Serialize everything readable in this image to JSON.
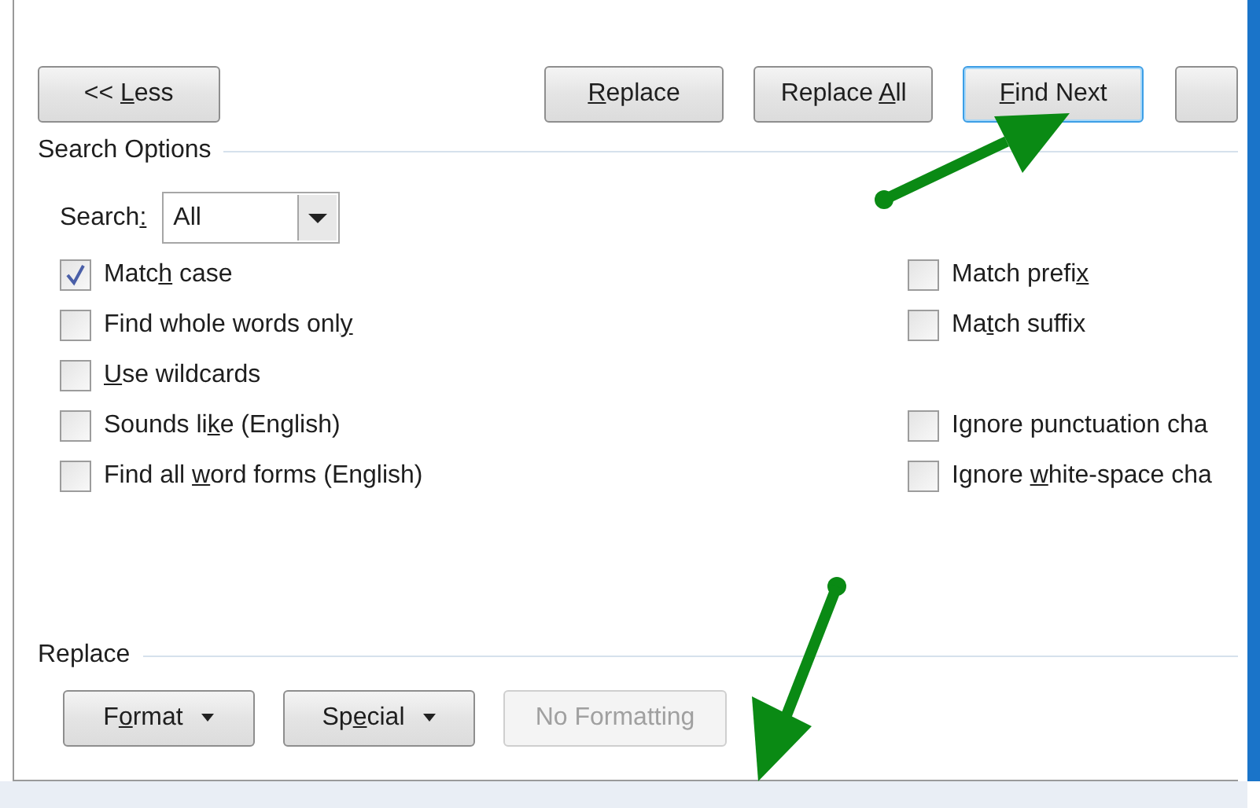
{
  "top_buttons": [
    {
      "label": {
        "pre": "<< ",
        "key": "L",
        "post": "ess"
      },
      "focused": false
    },
    {
      "label": {
        "key": "R",
        "post": "eplace"
      },
      "focused": false
    },
    {
      "label": {
        "pre": "Replace ",
        "key": "A",
        "post": "ll"
      },
      "focused": false
    },
    {
      "label": {
        "key": "F",
        "post": "ind Next"
      },
      "focused": true
    }
  ],
  "search_options": {
    "title": "Search Options",
    "search_label": {
      "pre": "Search",
      "key": ":"
    },
    "search_value": "All",
    "left_options": [
      {
        "label": {
          "pre": "Matc",
          "key": "h",
          "post": " case"
        },
        "checked": true
      },
      {
        "label": {
          "pre": "Find whole words onl",
          "key": "y"
        },
        "checked": false
      },
      {
        "label": {
          "key": "U",
          "post": "se wildcards"
        },
        "checked": false
      },
      {
        "label": {
          "pre": "Sounds li",
          "key": "k",
          "post": "e (English)"
        },
        "checked": false
      },
      {
        "label": {
          "pre": "Find all ",
          "key": "w",
          "post": "ord forms (English)"
        },
        "checked": false
      }
    ],
    "right_option_groups": [
      [
        {
          "label": {
            "pre": "Match prefi",
            "key": "x"
          },
          "checked": false
        },
        {
          "label": {
            "pre": "Ma",
            "key": "t",
            "post": "ch suffix"
          },
          "checked": false
        }
      ],
      [
        {
          "label": {
            "pre": "Ignore punctuation cha"
          },
          "checked": false
        },
        {
          "label": {
            "pre": "Ignore ",
            "key": "w",
            "post": "hite-space cha"
          },
          "checked": false
        }
      ]
    ]
  },
  "replace": {
    "title": "Replace",
    "buttons": [
      {
        "label": {
          "pre": "F",
          "key": "o",
          "post": "rmat"
        },
        "dropdown": true,
        "disabled": false
      },
      {
        "label": {
          "pre": "Sp",
          "key": "e",
          "post": "cial"
        },
        "dropdown": true,
        "disabled": false
      },
      {
        "label": {
          "pre": "No Formatting"
        },
        "dropdown": false,
        "disabled": true
      }
    ]
  }
}
